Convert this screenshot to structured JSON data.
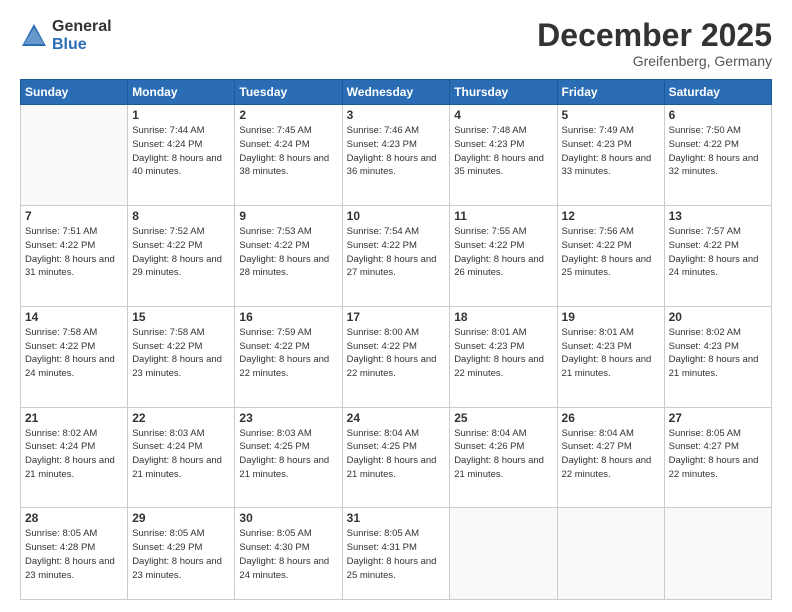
{
  "logo": {
    "general": "General",
    "blue": "Blue"
  },
  "header": {
    "month": "December 2025",
    "location": "Greifenberg, Germany"
  },
  "weekdays": [
    "Sunday",
    "Monday",
    "Tuesday",
    "Wednesday",
    "Thursday",
    "Friday",
    "Saturday"
  ],
  "weeks": [
    [
      {
        "day": "",
        "info": ""
      },
      {
        "day": "1",
        "info": "Sunrise: 7:44 AM\nSunset: 4:24 PM\nDaylight: 8 hours\nand 40 minutes."
      },
      {
        "day": "2",
        "info": "Sunrise: 7:45 AM\nSunset: 4:24 PM\nDaylight: 8 hours\nand 38 minutes."
      },
      {
        "day": "3",
        "info": "Sunrise: 7:46 AM\nSunset: 4:23 PM\nDaylight: 8 hours\nand 36 minutes."
      },
      {
        "day": "4",
        "info": "Sunrise: 7:48 AM\nSunset: 4:23 PM\nDaylight: 8 hours\nand 35 minutes."
      },
      {
        "day": "5",
        "info": "Sunrise: 7:49 AM\nSunset: 4:23 PM\nDaylight: 8 hours\nand 33 minutes."
      },
      {
        "day": "6",
        "info": "Sunrise: 7:50 AM\nSunset: 4:22 PM\nDaylight: 8 hours\nand 32 minutes."
      }
    ],
    [
      {
        "day": "7",
        "info": "Sunrise: 7:51 AM\nSunset: 4:22 PM\nDaylight: 8 hours\nand 31 minutes."
      },
      {
        "day": "8",
        "info": "Sunrise: 7:52 AM\nSunset: 4:22 PM\nDaylight: 8 hours\nand 29 minutes."
      },
      {
        "day": "9",
        "info": "Sunrise: 7:53 AM\nSunset: 4:22 PM\nDaylight: 8 hours\nand 28 minutes."
      },
      {
        "day": "10",
        "info": "Sunrise: 7:54 AM\nSunset: 4:22 PM\nDaylight: 8 hours\nand 27 minutes."
      },
      {
        "day": "11",
        "info": "Sunrise: 7:55 AM\nSunset: 4:22 PM\nDaylight: 8 hours\nand 26 minutes."
      },
      {
        "day": "12",
        "info": "Sunrise: 7:56 AM\nSunset: 4:22 PM\nDaylight: 8 hours\nand 25 minutes."
      },
      {
        "day": "13",
        "info": "Sunrise: 7:57 AM\nSunset: 4:22 PM\nDaylight: 8 hours\nand 24 minutes."
      }
    ],
    [
      {
        "day": "14",
        "info": "Sunrise: 7:58 AM\nSunset: 4:22 PM\nDaylight: 8 hours\nand 24 minutes."
      },
      {
        "day": "15",
        "info": "Sunrise: 7:58 AM\nSunset: 4:22 PM\nDaylight: 8 hours\nand 23 minutes."
      },
      {
        "day": "16",
        "info": "Sunrise: 7:59 AM\nSunset: 4:22 PM\nDaylight: 8 hours\nand 22 minutes."
      },
      {
        "day": "17",
        "info": "Sunrise: 8:00 AM\nSunset: 4:22 PM\nDaylight: 8 hours\nand 22 minutes."
      },
      {
        "day": "18",
        "info": "Sunrise: 8:01 AM\nSunset: 4:23 PM\nDaylight: 8 hours\nand 22 minutes."
      },
      {
        "day": "19",
        "info": "Sunrise: 8:01 AM\nSunset: 4:23 PM\nDaylight: 8 hours\nand 21 minutes."
      },
      {
        "day": "20",
        "info": "Sunrise: 8:02 AM\nSunset: 4:23 PM\nDaylight: 8 hours\nand 21 minutes."
      }
    ],
    [
      {
        "day": "21",
        "info": "Sunrise: 8:02 AM\nSunset: 4:24 PM\nDaylight: 8 hours\nand 21 minutes."
      },
      {
        "day": "22",
        "info": "Sunrise: 8:03 AM\nSunset: 4:24 PM\nDaylight: 8 hours\nand 21 minutes."
      },
      {
        "day": "23",
        "info": "Sunrise: 8:03 AM\nSunset: 4:25 PM\nDaylight: 8 hours\nand 21 minutes."
      },
      {
        "day": "24",
        "info": "Sunrise: 8:04 AM\nSunset: 4:25 PM\nDaylight: 8 hours\nand 21 minutes."
      },
      {
        "day": "25",
        "info": "Sunrise: 8:04 AM\nSunset: 4:26 PM\nDaylight: 8 hours\nand 21 minutes."
      },
      {
        "day": "26",
        "info": "Sunrise: 8:04 AM\nSunset: 4:27 PM\nDaylight: 8 hours\nand 22 minutes."
      },
      {
        "day": "27",
        "info": "Sunrise: 8:05 AM\nSunset: 4:27 PM\nDaylight: 8 hours\nand 22 minutes."
      }
    ],
    [
      {
        "day": "28",
        "info": "Sunrise: 8:05 AM\nSunset: 4:28 PM\nDaylight: 8 hours\nand 23 minutes."
      },
      {
        "day": "29",
        "info": "Sunrise: 8:05 AM\nSunset: 4:29 PM\nDaylight: 8 hours\nand 23 minutes."
      },
      {
        "day": "30",
        "info": "Sunrise: 8:05 AM\nSunset: 4:30 PM\nDaylight: 8 hours\nand 24 minutes."
      },
      {
        "day": "31",
        "info": "Sunrise: 8:05 AM\nSunset: 4:31 PM\nDaylight: 8 hours\nand 25 minutes."
      },
      {
        "day": "",
        "info": ""
      },
      {
        "day": "",
        "info": ""
      },
      {
        "day": "",
        "info": ""
      }
    ]
  ]
}
